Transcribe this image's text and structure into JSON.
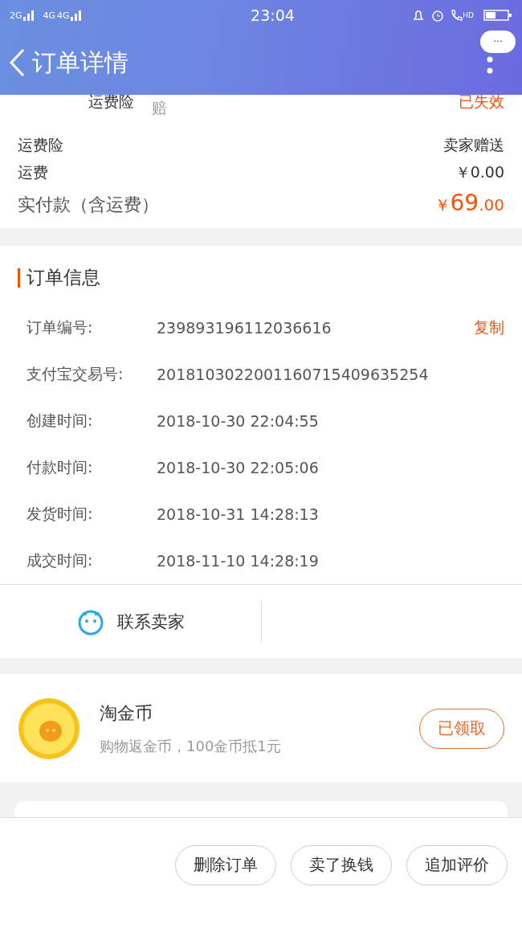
{
  "status_bar": {
    "network_1": "2G",
    "network_2": "4G",
    "network_3": "4G",
    "call_badge": "HD",
    "time": "23:04"
  },
  "nav": {
    "title": "订单详情",
    "menu_badge": "···"
  },
  "insurance_row": {
    "label": "运费险",
    "note": "赔",
    "status": "已失效"
  },
  "fees": [
    {
      "label": "运费险",
      "value": "卖家赠送",
      "kind": "plain"
    },
    {
      "label": "运费",
      "value": "￥0.00",
      "kind": "plain"
    },
    {
      "label": "实付款（含运费）",
      "currency": "￥",
      "amount": "69",
      "cents": ".00",
      "kind": "total"
    }
  ],
  "order_info": {
    "title": "订单信息",
    "rows": [
      {
        "label": "订单编号:",
        "value": "239893196112036616",
        "action": "复制"
      },
      {
        "label": "支付宝交易号:",
        "value": "2018103022001160715409635254"
      },
      {
        "label": "创建时间:",
        "value": "2018-10-30 22:04:55"
      },
      {
        "label": "付款时间:",
        "value": "2018-10-30 22:05:06"
      },
      {
        "label": "发货时间:",
        "value": "2018-10-31 14:28:13"
      },
      {
        "label": "成交时间:",
        "value": "2018-11-10 14:28:19"
      }
    ]
  },
  "contact": {
    "label": "联系卖家"
  },
  "coins": {
    "title": "淘金币",
    "subtitle": "购物返金币，100金币抵1元",
    "button": "已领取"
  },
  "actions": [
    "删除订单",
    "卖了换钱",
    "追加评价"
  ]
}
